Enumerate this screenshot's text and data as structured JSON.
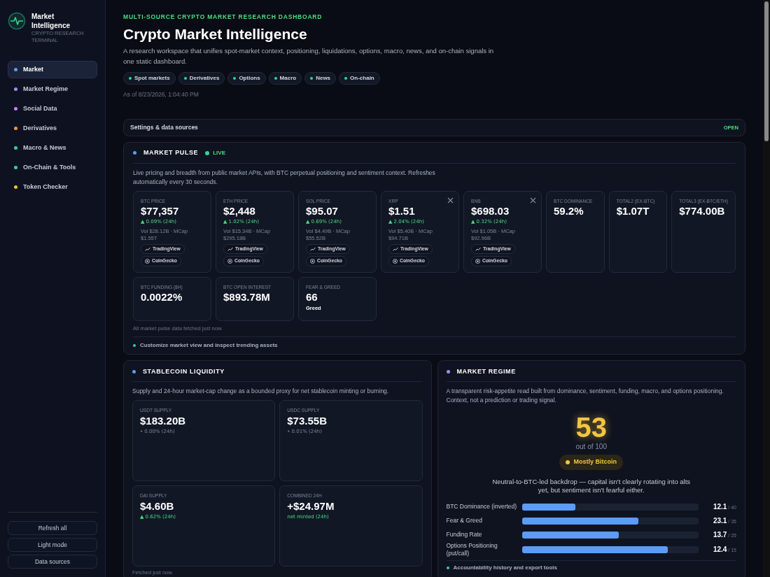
{
  "sidebar": {
    "brand": {
      "title": "Market Intelligence",
      "subtitle": "CRYPTO RESEARCH TERMINAL"
    },
    "items": [
      {
        "label": "Market",
        "selected": true,
        "color": "#5b9cf6"
      },
      {
        "label": "Market Regime",
        "selected": false,
        "color": "#a78bfa"
      },
      {
        "label": "Social Data",
        "selected": false,
        "color": "#c084fc"
      },
      {
        "label": "Derivatives",
        "selected": false,
        "color": "#fb923c"
      },
      {
        "label": "Macro & News",
        "selected": false,
        "color": "#34d399"
      },
      {
        "label": "On-Chain & Tools",
        "selected": false,
        "color": "#34d399"
      },
      {
        "label": "Token Checker",
        "selected": false,
        "color": "#fbbf24"
      }
    ],
    "buttons": [
      "Refresh all",
      "Light mode",
      "Data sources"
    ]
  },
  "header": {
    "eyebrow": "MULTI-SOURCE CRYPTO MARKET RESEARCH DASHBOARD",
    "title": "Crypto Market Intelligence",
    "description": "A research workspace that unifies spot-market context, positioning, liquidations, options, macro, news, and on-chain signals in one static dashboard.",
    "chips": [
      "Spot markets",
      "Derivatives",
      "Options",
      "Macro",
      "News",
      "On-chain"
    ],
    "as_of": "As of 8/23/2026, 1:04:40 PM"
  },
  "settings": {
    "label": "Settings & data sources",
    "action": "OPEN"
  },
  "market_pulse": {
    "title": "MARKET PULSE",
    "live": "LIVE",
    "description": "Live pricing and breadth from public market APIs, with BTC perpetual positioning and sentiment context. Refreshes automatically every 30 seconds.",
    "cards": [
      {
        "kind": "asset",
        "label": "BTC PRICE",
        "value": "$77,357",
        "change": "▲ 0.09% (24h)",
        "positive": true,
        "detail": "Vol $28.12B · MCap $1.55T",
        "links": [
          "TradingView",
          "CoinGecko"
        ],
        "removable": false
      },
      {
        "kind": "asset",
        "label": "ETH PRICE",
        "value": "$2,448",
        "change": "▲ 1.02% (24h)",
        "positive": true,
        "detail": "Vol $15.34B · MCap $295.18B",
        "links": [
          "TradingView",
          "CoinGecko"
        ],
        "removable": false
      },
      {
        "kind": "asset",
        "label": "SOL PRICE",
        "value": "$95.07",
        "change": "▲ 0.69% (24h)",
        "positive": true,
        "detail": "Vol $4.49B · MCap $55.52B",
        "links": [
          "TradingView",
          "CoinGecko"
        ],
        "removable": false
      },
      {
        "kind": "asset",
        "label": "XRP",
        "value": "$1.51",
        "change": "▲ 2.04% (24h)",
        "positive": true,
        "detail": "Vol $5.40B · MCap $94.71B",
        "links": [
          "TradingView",
          "CoinGecko"
        ],
        "removable": true
      },
      {
        "kind": "asset",
        "label": "BNB",
        "value": "$698.03",
        "change": "▲ 0.32% (24h)",
        "positive": true,
        "detail": "Vol $1.05B · MCap $92.96B",
        "links": [
          "TradingView",
          "CoinGecko"
        ],
        "removable": true
      },
      {
        "kind": "stat",
        "label": "BTC DOMINANCE",
        "value": "59.2%"
      },
      {
        "kind": "stat",
        "label": "TOTAL2 (EX-BTC)",
        "value": "$1.07T"
      },
      {
        "kind": "stat",
        "label": "TOTAL3 (EX-BTC/ETH)",
        "value": "$774.00B"
      },
      {
        "kind": "stat",
        "label": "BTC FUNDING (8H)",
        "value": "0.0022%"
      },
      {
        "kind": "stat",
        "label": "BTC OPEN INTEREST",
        "value": "$893.78M"
      },
      {
        "kind": "stat",
        "label": "FEAR & GREED",
        "value": "66",
        "note": "Greed"
      }
    ],
    "footnote": "All market pulse data fetched just now.",
    "expander": "Customize market view and inspect trending assets"
  },
  "stablecoin": {
    "title": "STABLECOIN LIQUIDITY",
    "description": "Supply and 24-hour market-cap change as a bounded proxy for net stablecoin minting or burning.",
    "cards": [
      {
        "label": "USDT SUPPLY",
        "value": "$183.20B",
        "change": "• 0.00% (24h)",
        "positive": false
      },
      {
        "label": "USDC SUPPLY",
        "value": "$73.55B",
        "change": "• 0.01% (24h)",
        "positive": false
      },
      {
        "label": "DAI SUPPLY",
        "value": "$4.60B",
        "change": "▲ 0.62% (24h)",
        "positive": true
      },
      {
        "label": "COMBINED 24H",
        "value": "+$24.97M",
        "change": "net minted (24h)",
        "positive": true
      }
    ],
    "footnote": "Fetched just now."
  },
  "market_regime": {
    "title": "MARKET REGIME",
    "description": "A transparent risk-appetite read built from dominance, sentiment, funding, macro, and options positioning. Context, not a prediction or trading signal.",
    "score": "53",
    "score_caption": "out of 100",
    "badge": "Mostly Bitcoin",
    "summary": "Neutral-to-BTC-led backdrop — capital isn't clearly rotating into alts yet, but sentiment isn't fearful either.",
    "factors": [
      {
        "label": "BTC Dominance (inverted)",
        "level": 0.3025,
        "value": "12.1",
        "max": "/ 40"
      },
      {
        "label": "Fear & Greed",
        "level": 0.66,
        "value": "23.1",
        "max": "/ 35"
      },
      {
        "label": "Funding Rate",
        "level": 0.548,
        "value": "13.7",
        "max": "/ 25"
      },
      {
        "label": "Options Positioning (put/call)",
        "level": 0.827,
        "value": "12.4",
        "max": "/ 15"
      }
    ],
    "expander": "Accountability history and export tools"
  }
}
